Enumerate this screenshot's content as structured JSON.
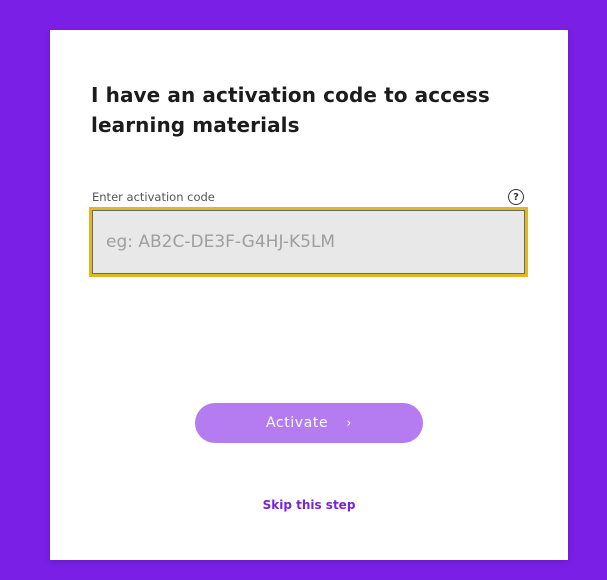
{
  "colors": {
    "background": "#7a1fe6",
    "card": "#ffffff",
    "input_focus_border": "#e3b723",
    "input_fill": "#e8e8e8",
    "button_fill": "#b57bf1",
    "link": "#7a22d8"
  },
  "activation": {
    "title": "I have an activation code to access learning materials",
    "field_label": "Enter activation code",
    "help_icon": "?",
    "input_value": "",
    "input_placeholder": "eg: AB2C-DE3F-G4HJ-K5LM",
    "activate_label": "Activate",
    "activate_icon": "›",
    "skip_label": "Skip this step"
  },
  "icons": {
    "help": "question-circle-icon",
    "activate_arrow": "chevron-right-icon"
  }
}
